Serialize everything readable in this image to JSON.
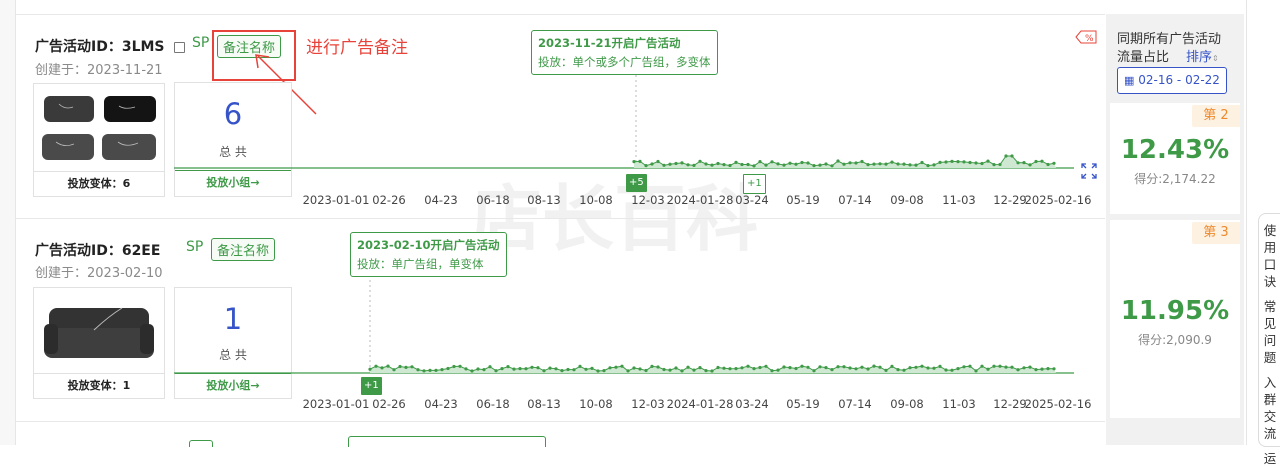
{
  "rows": [
    {
      "title": "广告活动ID：3LMS",
      "created": "创建于：2023-11-21",
      "badge": "SP",
      "note_label": "备注名称",
      "variants_label": "投放变体：6",
      "count": "6",
      "count_label": "总 共",
      "group_label": "投放小组→",
      "tip_title": "2023-11-21开启广告活动",
      "tip_desc": "投放：单个或多个广告组，多变体",
      "markers": [
        "+5",
        "+1"
      ],
      "rank": "第 2",
      "percent": "12.43%",
      "score": "得分:2,174.22"
    },
    {
      "title": "广告活动ID：62EE",
      "created": "创建于：2023-02-10",
      "badge": "SP",
      "note_label": "备注名称",
      "variants_label": "投放变体：1",
      "count": "1",
      "count_label": "总 共",
      "group_label": "投放小组→",
      "tip_title": "2023-02-10开启广告活动",
      "tip_desc": "投放：单广告组，单变体",
      "markers": [
        "+1"
      ],
      "rank": "第 3",
      "percent": "11.95%",
      "score": "得分:2,090.9"
    }
  ],
  "annotation": "进行广告备注",
  "x_ticks": [
    "2023-01-01",
    "02-26",
    "04-23",
    "06-18",
    "08-13",
    "10-08",
    "12-03",
    "2024-01-28",
    "03-24",
    "05-19",
    "07-14",
    "09-08",
    "11-03",
    "12-29",
    "2025-02-16"
  ],
  "side_header": {
    "line1": "同期所有广告活动",
    "line2": "流量占比",
    "sort": "排序"
  },
  "date_range": "02-16 - 02-22",
  "right_tab": [
    "使",
    "用",
    "口",
    "诀",
    "常",
    "见",
    "问",
    "题",
    "入",
    "群",
    "交",
    "流",
    "运"
  ],
  "watermark": "店长百科",
  "colors": {
    "accent_green": "#3f9a48",
    "accent_blue": "#3654c8",
    "annotation_red": "#e8433a",
    "rank_orange": "#ee8a2d"
  },
  "icons": [
    "copy-icon",
    "tag-icon",
    "expand-icon",
    "calendar-icon",
    "sort-icon"
  ]
}
